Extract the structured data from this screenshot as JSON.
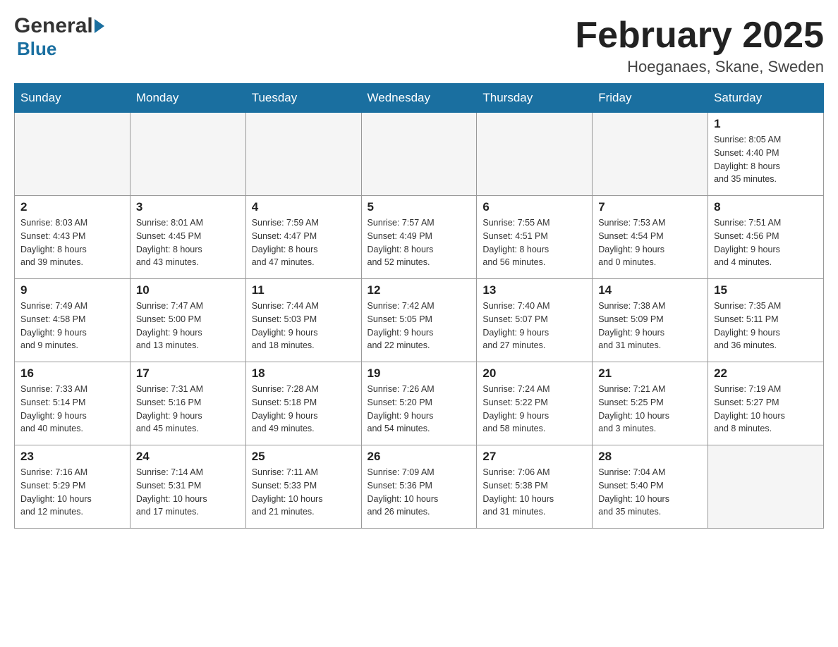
{
  "header": {
    "logo_general": "General",
    "logo_blue": "Blue",
    "month_title": "February 2025",
    "location": "Hoeganaes, Skane, Sweden"
  },
  "weekdays": [
    "Sunday",
    "Monday",
    "Tuesday",
    "Wednesday",
    "Thursday",
    "Friday",
    "Saturday"
  ],
  "weeks": [
    [
      {
        "day": "",
        "info": ""
      },
      {
        "day": "",
        "info": ""
      },
      {
        "day": "",
        "info": ""
      },
      {
        "day": "",
        "info": ""
      },
      {
        "day": "",
        "info": ""
      },
      {
        "day": "",
        "info": ""
      },
      {
        "day": "1",
        "info": "Sunrise: 8:05 AM\nSunset: 4:40 PM\nDaylight: 8 hours\nand 35 minutes."
      }
    ],
    [
      {
        "day": "2",
        "info": "Sunrise: 8:03 AM\nSunset: 4:43 PM\nDaylight: 8 hours\nand 39 minutes."
      },
      {
        "day": "3",
        "info": "Sunrise: 8:01 AM\nSunset: 4:45 PM\nDaylight: 8 hours\nand 43 minutes."
      },
      {
        "day": "4",
        "info": "Sunrise: 7:59 AM\nSunset: 4:47 PM\nDaylight: 8 hours\nand 47 minutes."
      },
      {
        "day": "5",
        "info": "Sunrise: 7:57 AM\nSunset: 4:49 PM\nDaylight: 8 hours\nand 52 minutes."
      },
      {
        "day": "6",
        "info": "Sunrise: 7:55 AM\nSunset: 4:51 PM\nDaylight: 8 hours\nand 56 minutes."
      },
      {
        "day": "7",
        "info": "Sunrise: 7:53 AM\nSunset: 4:54 PM\nDaylight: 9 hours\nand 0 minutes."
      },
      {
        "day": "8",
        "info": "Sunrise: 7:51 AM\nSunset: 4:56 PM\nDaylight: 9 hours\nand 4 minutes."
      }
    ],
    [
      {
        "day": "9",
        "info": "Sunrise: 7:49 AM\nSunset: 4:58 PM\nDaylight: 9 hours\nand 9 minutes."
      },
      {
        "day": "10",
        "info": "Sunrise: 7:47 AM\nSunset: 5:00 PM\nDaylight: 9 hours\nand 13 minutes."
      },
      {
        "day": "11",
        "info": "Sunrise: 7:44 AM\nSunset: 5:03 PM\nDaylight: 9 hours\nand 18 minutes."
      },
      {
        "day": "12",
        "info": "Sunrise: 7:42 AM\nSunset: 5:05 PM\nDaylight: 9 hours\nand 22 minutes."
      },
      {
        "day": "13",
        "info": "Sunrise: 7:40 AM\nSunset: 5:07 PM\nDaylight: 9 hours\nand 27 minutes."
      },
      {
        "day": "14",
        "info": "Sunrise: 7:38 AM\nSunset: 5:09 PM\nDaylight: 9 hours\nand 31 minutes."
      },
      {
        "day": "15",
        "info": "Sunrise: 7:35 AM\nSunset: 5:11 PM\nDaylight: 9 hours\nand 36 minutes."
      }
    ],
    [
      {
        "day": "16",
        "info": "Sunrise: 7:33 AM\nSunset: 5:14 PM\nDaylight: 9 hours\nand 40 minutes."
      },
      {
        "day": "17",
        "info": "Sunrise: 7:31 AM\nSunset: 5:16 PM\nDaylight: 9 hours\nand 45 minutes."
      },
      {
        "day": "18",
        "info": "Sunrise: 7:28 AM\nSunset: 5:18 PM\nDaylight: 9 hours\nand 49 minutes."
      },
      {
        "day": "19",
        "info": "Sunrise: 7:26 AM\nSunset: 5:20 PM\nDaylight: 9 hours\nand 54 minutes."
      },
      {
        "day": "20",
        "info": "Sunrise: 7:24 AM\nSunset: 5:22 PM\nDaylight: 9 hours\nand 58 minutes."
      },
      {
        "day": "21",
        "info": "Sunrise: 7:21 AM\nSunset: 5:25 PM\nDaylight: 10 hours\nand 3 minutes."
      },
      {
        "day": "22",
        "info": "Sunrise: 7:19 AM\nSunset: 5:27 PM\nDaylight: 10 hours\nand 8 minutes."
      }
    ],
    [
      {
        "day": "23",
        "info": "Sunrise: 7:16 AM\nSunset: 5:29 PM\nDaylight: 10 hours\nand 12 minutes."
      },
      {
        "day": "24",
        "info": "Sunrise: 7:14 AM\nSunset: 5:31 PM\nDaylight: 10 hours\nand 17 minutes."
      },
      {
        "day": "25",
        "info": "Sunrise: 7:11 AM\nSunset: 5:33 PM\nDaylight: 10 hours\nand 21 minutes."
      },
      {
        "day": "26",
        "info": "Sunrise: 7:09 AM\nSunset: 5:36 PM\nDaylight: 10 hours\nand 26 minutes."
      },
      {
        "day": "27",
        "info": "Sunrise: 7:06 AM\nSunset: 5:38 PM\nDaylight: 10 hours\nand 31 minutes."
      },
      {
        "day": "28",
        "info": "Sunrise: 7:04 AM\nSunset: 5:40 PM\nDaylight: 10 hours\nand 35 minutes."
      },
      {
        "day": "",
        "info": ""
      }
    ]
  ]
}
